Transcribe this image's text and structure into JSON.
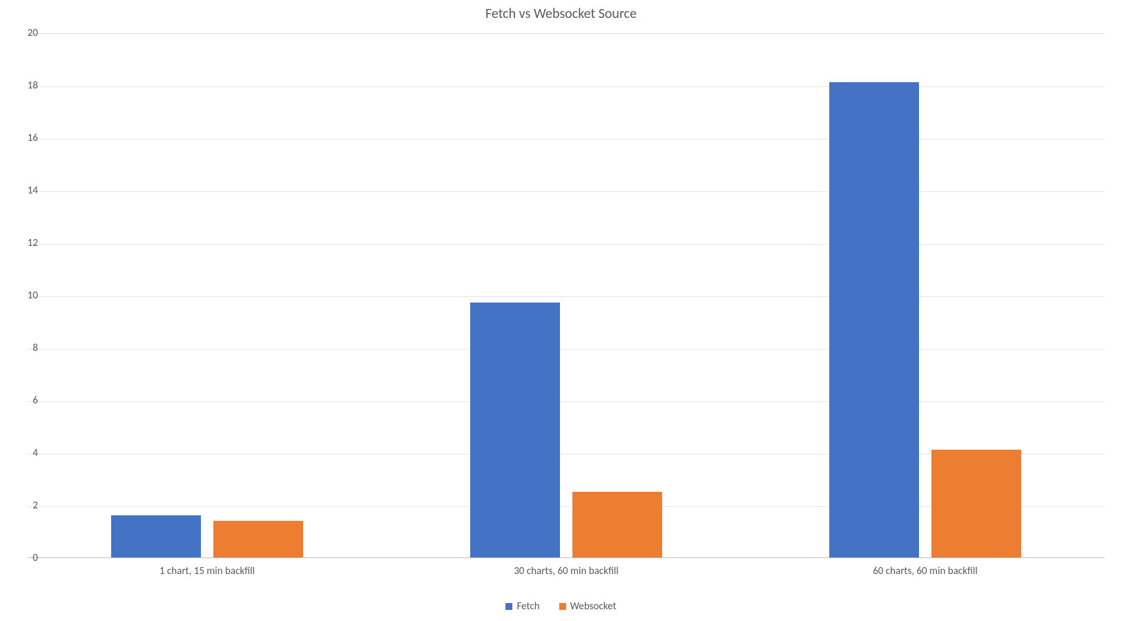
{
  "chart_data": {
    "type": "bar",
    "title": "Fetch vs Websocket Source",
    "xlabel": "",
    "ylabel": "",
    "ylim": [
      0,
      20
    ],
    "yticks": [
      0,
      2,
      4,
      6,
      8,
      10,
      12,
      14,
      16,
      18,
      20
    ],
    "categories": [
      "1 chart, 15 min backfill",
      "30 charts, 60 min backfill",
      "60 charts, 60 min backfill"
    ],
    "series": [
      {
        "name": "Fetch",
        "color": "#4472c4",
        "values": [
          1.6,
          9.7,
          18.1
        ]
      },
      {
        "name": "Websocket",
        "color": "#ed7d31",
        "values": [
          1.4,
          2.5,
          4.1
        ]
      }
    ],
    "legend_position": "bottom",
    "grid": true
  }
}
